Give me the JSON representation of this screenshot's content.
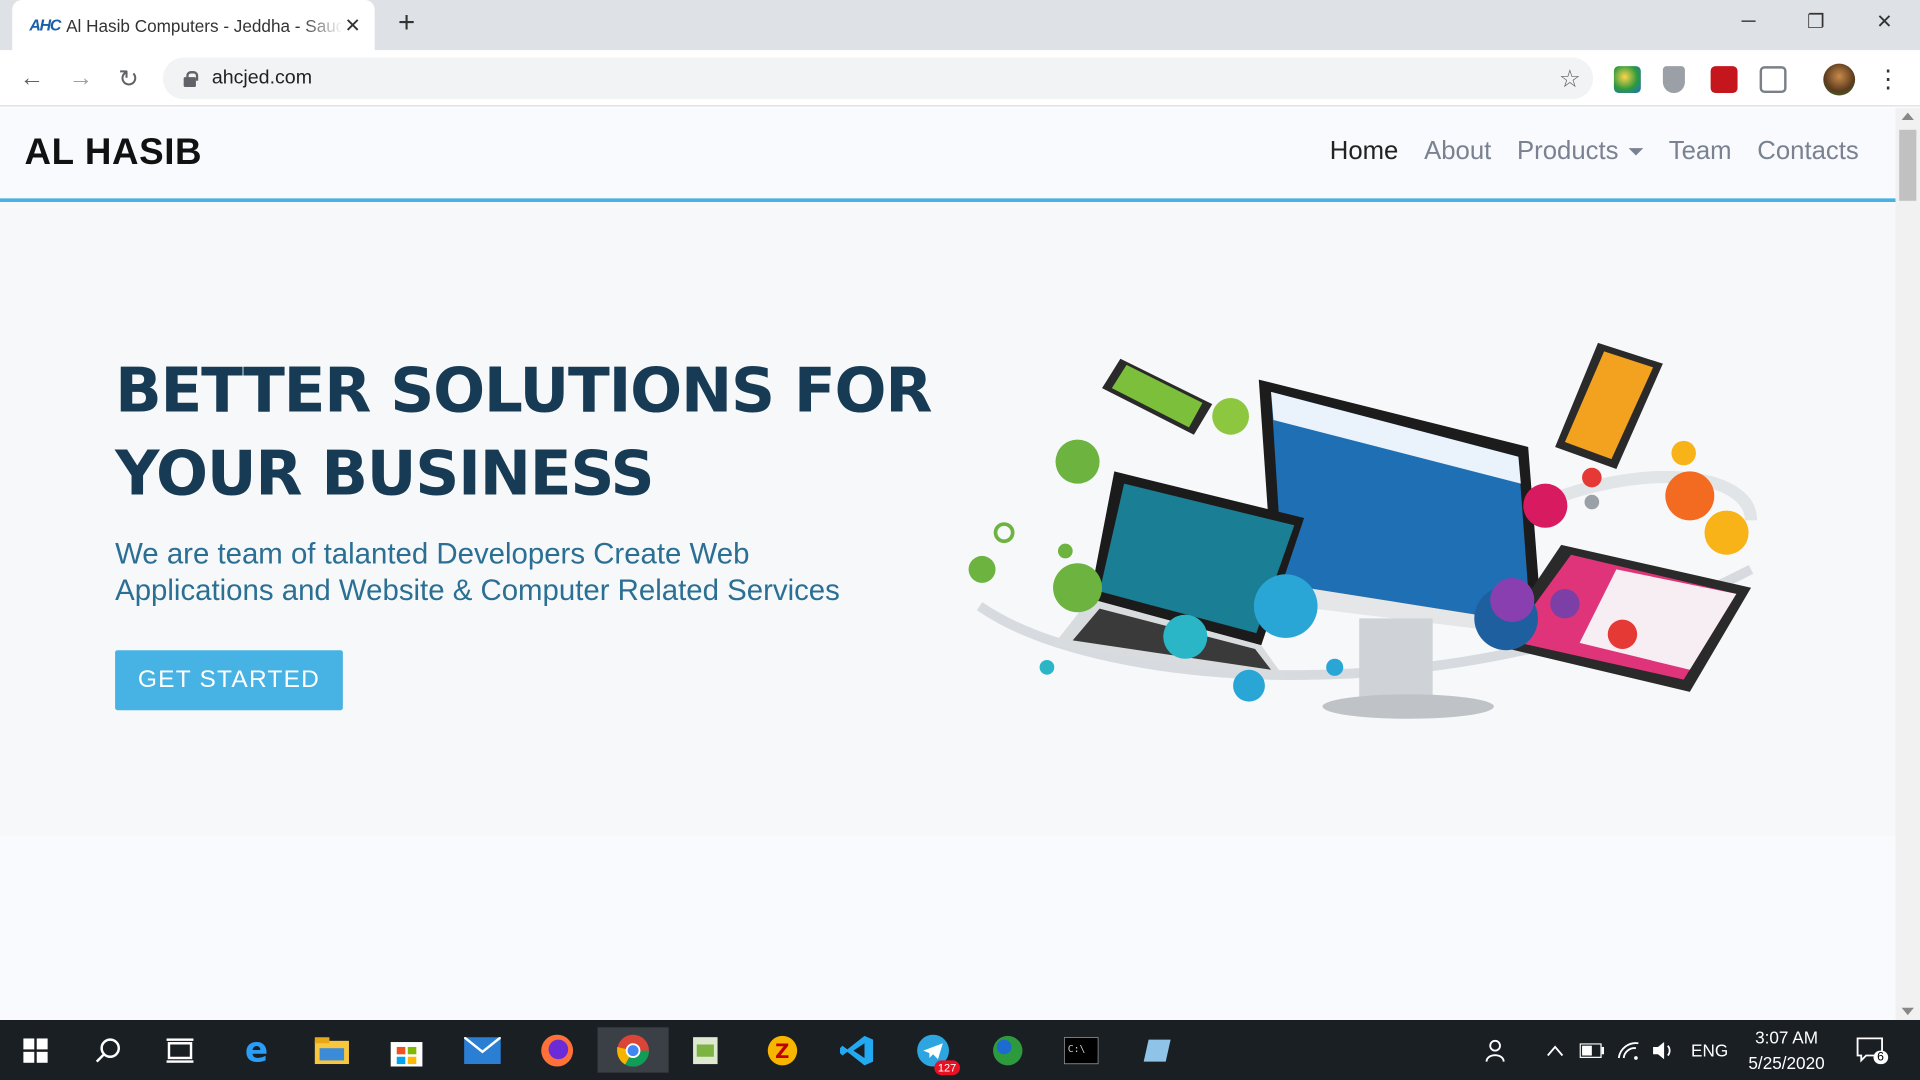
{
  "browser": {
    "tab_favicon": "AHC",
    "tab_title": "Al Hasib Computers - Jeddha - Saudi",
    "tab_close": "✕",
    "new_tab": "+",
    "url": "ahcjed.com",
    "back": "←",
    "forward": "→",
    "reload": "↻",
    "star": "☆",
    "minimize": "─",
    "restore": "❐",
    "close": "✕",
    "menu": "⋮"
  },
  "site": {
    "logo": "AL HASIB",
    "nav": {
      "home": "Home",
      "about": "About",
      "products": "Products",
      "team": "Team",
      "contacts": "Contacts"
    },
    "hero": {
      "title": "BETTER SOLUTIONS FOR YOUR BUSINESS",
      "subtitle": "We are team of talanted Developers Create Web Applications and Website & Computer Related Services",
      "cta": "GET STARTED"
    }
  },
  "taskbar": {
    "telegram_badge": "127",
    "lang": "ENG",
    "time": "3:07 AM",
    "date": "5/25/2020",
    "notification_count": "6"
  },
  "colors": {
    "accent": "#47b2e4",
    "title": "#173b54",
    "subtitle": "#2b6f94"
  }
}
